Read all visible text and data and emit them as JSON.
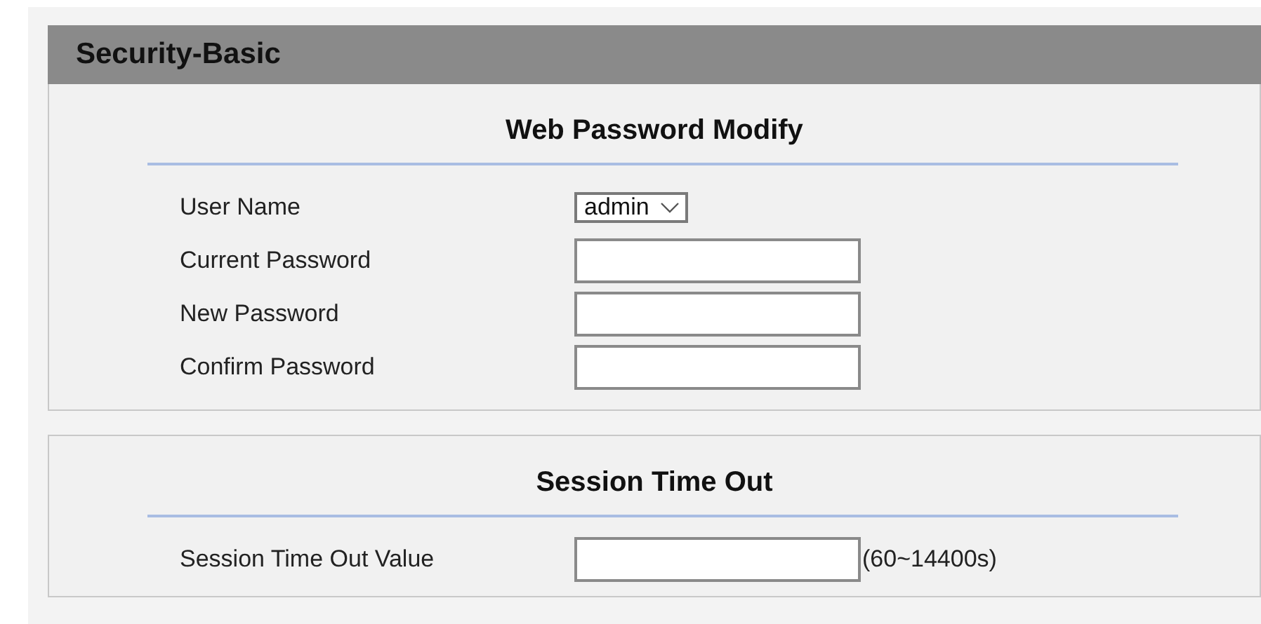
{
  "page_title": "Security-Basic",
  "sections": [
    {
      "title": "Web Password Modify",
      "rows": [
        {
          "label": "User Name",
          "kind": "select",
          "value": "admin"
        },
        {
          "label": "Current Password",
          "kind": "text"
        },
        {
          "label": "New Password",
          "kind": "text"
        },
        {
          "label": "Confirm Password",
          "kind": "text"
        }
      ]
    },
    {
      "title": "Session Time Out",
      "rows": [
        {
          "label": "Session Time Out Value",
          "kind": "text",
          "hint": "(60~14400s)"
        }
      ]
    }
  ]
}
